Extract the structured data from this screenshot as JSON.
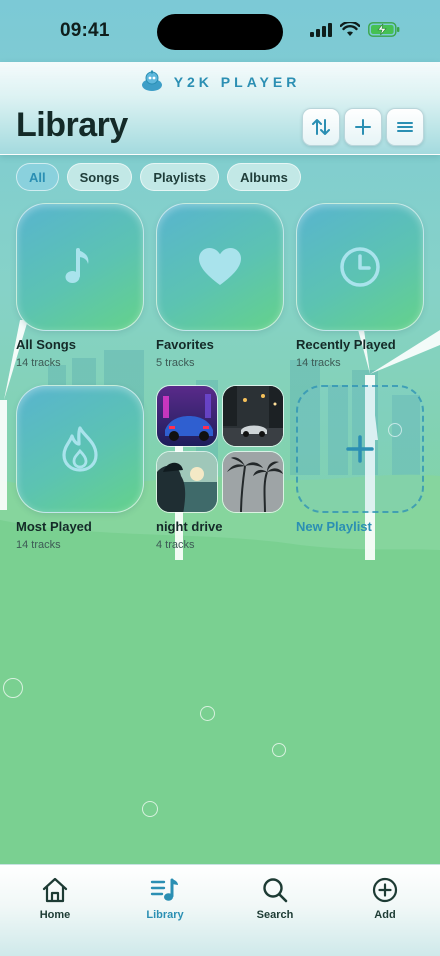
{
  "status_bar": {
    "time": "09:41",
    "icons": [
      "signal-icon",
      "wifi-icon",
      "battery-charging-icon"
    ]
  },
  "header": {
    "brand": "Y2K PLAYER",
    "brand_icon": "robot-mascot-icon",
    "title": "Library",
    "actions": [
      {
        "icon": "sort-icon"
      },
      {
        "icon": "plus-icon"
      },
      {
        "icon": "menu-icon"
      }
    ]
  },
  "filters": {
    "selected": "All",
    "items": [
      "All",
      "Songs",
      "Playlists",
      "Albums"
    ]
  },
  "library_items": [
    {
      "title": "All Songs",
      "subtitle": "14 tracks",
      "icon": "music-note-icon"
    },
    {
      "title": "Favorites",
      "subtitle": "5 tracks",
      "icon": "heart-icon"
    },
    {
      "title": "Recently Played",
      "subtitle": "14 tracks",
      "icon": "clock-icon"
    },
    {
      "title": "Most Played",
      "subtitle": "14 tracks",
      "icon": "flame-icon"
    },
    {
      "title": "night drive",
      "subtitle": "4 tracks",
      "icon": "album-collage"
    },
    {
      "title": "New Playlist",
      "icon": "plus-icon"
    }
  ],
  "tab_bar": {
    "selected": "Library",
    "tabs": [
      {
        "label": "Home",
        "icon": "home-icon"
      },
      {
        "label": "Library",
        "icon": "library-icon"
      },
      {
        "label": "Search",
        "icon": "search-icon"
      },
      {
        "label": "Add",
        "icon": "add-circle-icon"
      }
    ]
  },
  "colors": {
    "accent": "#2b8fb3",
    "tile_gradient_start": "#58b4cf",
    "tile_gradient_end": "#64d28a",
    "title_text": "#142a28"
  }
}
